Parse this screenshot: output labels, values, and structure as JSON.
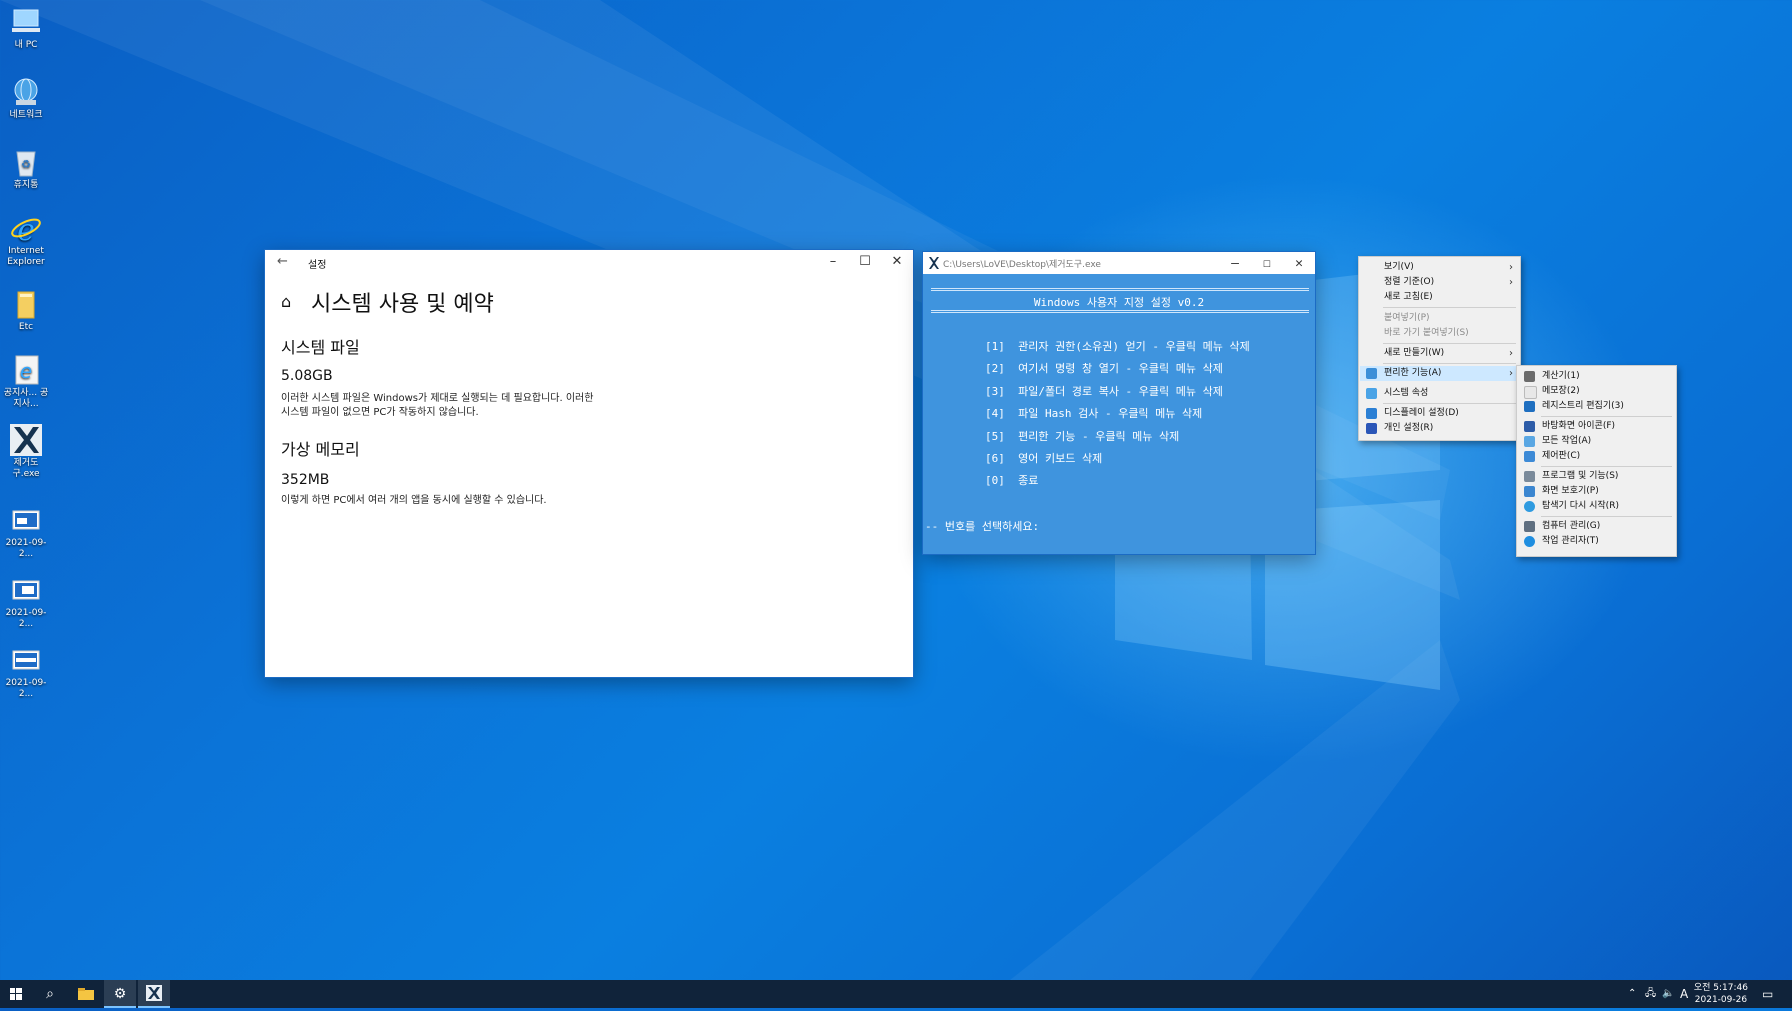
{
  "desktop": {
    "icons": [
      {
        "label": "내 PC",
        "name": "this-pc-icon"
      },
      {
        "label": "네트워크",
        "name": "network-icon"
      },
      {
        "label": "휴지통",
        "name": "recycle-bin-icon"
      },
      {
        "label": "Internet Explorer",
        "name": "internet-explorer-icon"
      },
      {
        "label": "Etc",
        "name": "folder-icon"
      },
      {
        "label": "공지사... 공지사...",
        "name": "ie-shortcut-icon"
      },
      {
        "label": "제거도구.exe",
        "name": "remover-tool-icon"
      },
      {
        "label": "2021-09-2...",
        "name": "screenshot-file-icon"
      },
      {
        "label": "2021-09-2...",
        "name": "screenshot-file-icon"
      },
      {
        "label": "2021-09-2...",
        "name": "screenshot-file-icon"
      }
    ]
  },
  "settings": {
    "title": "설정",
    "page_title": "시스템 사용 및 예약",
    "sections": [
      {
        "heading": "시스템 파일",
        "size": "5.08GB",
        "desc": "이러한 시스템 파일은 Windows가 제대로 실행되는 데 필요합니다. 이러한 시스템 파일이 없으면 PC가 작동하지 않습니다."
      },
      {
        "heading": "가상 메모리",
        "size": "352MB",
        "desc": "이렇게 하면 PC에서 여러 개의 앱을 동시에 실행할 수 있습니다."
      }
    ]
  },
  "console": {
    "title": "C:\\Users\\LoVE\\Desktop\\제거도구.exe",
    "header": "Windows 사용자 지정 설정 v0.2",
    "items": [
      "[1]  관리자 권한(소유권) 얻기 - 우클릭 메뉴 삭제",
      "[2]  여기서 명령 창 열기 - 우클릭 메뉴 삭제",
      "[3]  파일/폴더 경로 복사 - 우클릭 메뉴 삭제",
      "[4]  파일 Hash 검사 - 우클릭 메뉴 삭제",
      "[5]  편리한 기능 - 우클릭 메뉴 삭제",
      "[6]  영어 키보드 삭제",
      "[0]  종료"
    ],
    "prompt": "-- 번호를 선택하세요:"
  },
  "context_menu": {
    "items": [
      {
        "label": "보기(V)",
        "arrow": true
      },
      {
        "label": "정렬 기준(O)",
        "arrow": true
      },
      {
        "label": "새로 고침(E)"
      },
      {
        "label": "붙여넣기(P)",
        "disabled": true
      },
      {
        "label": "바로 가기 붙여넣기(S)",
        "disabled": true
      },
      {
        "label": "새로 만들기(W)",
        "arrow": true
      },
      {
        "label": "편리한 기능(A)",
        "arrow": true,
        "highlighted": true
      },
      {
        "label": "시스템 속성"
      },
      {
        "label": "디스플레이 설정(D)"
      },
      {
        "label": "개인 설정(R)"
      }
    ]
  },
  "submenu": {
    "items": [
      {
        "label": "계산기(1)"
      },
      {
        "label": "메모장(2)"
      },
      {
        "label": "레지스트리 편집기(3)"
      },
      {
        "label": "바탕화면 아이콘(F)"
      },
      {
        "label": "모든 작업(A)"
      },
      {
        "label": "제어판(C)"
      },
      {
        "label": "프로그램 및 기능(S)"
      },
      {
        "label": "화면 보호기(P)"
      },
      {
        "label": "탐색기 다시 시작(R)"
      },
      {
        "label": "컴퓨터 관리(G)"
      },
      {
        "label": "작업 관리자(T)"
      }
    ]
  },
  "taskbar": {
    "ime": "A",
    "time_line1": "오전 5:17:46",
    "time_line2": "2021-09-26"
  }
}
